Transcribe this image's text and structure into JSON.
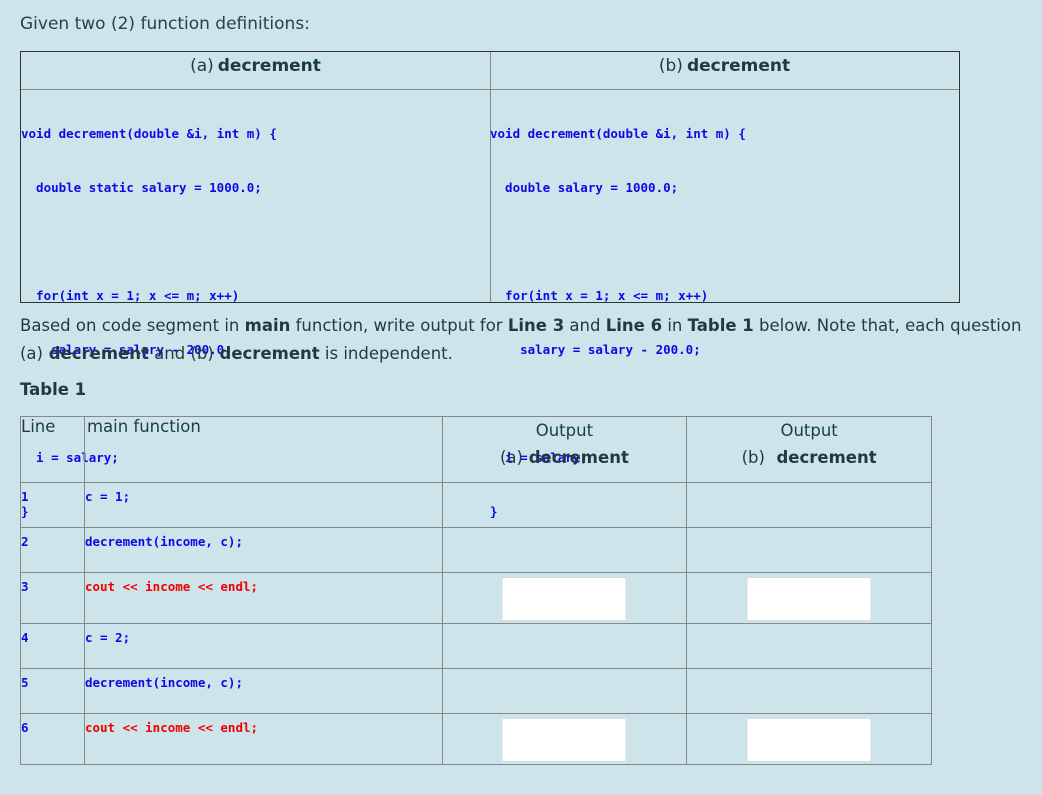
{
  "intro": "Given two (2) function definitions:",
  "definitions": [
    {
      "paren": "(a)",
      "name": "decrement",
      "code": [
        "void decrement(double &i, int m) {",
        "  double static salary = 1000.0;",
        "",
        "  for(int x = 1; x <= m; x++)",
        "    salary = salary - 200.0;",
        "",
        "  i = salary;",
        "}"
      ]
    },
    {
      "paren": "(b)",
      "name": "decrement",
      "code": [
        "void decrement(double &i, int m) {",
        "  double salary = 1000.0;",
        "",
        "  for(int x = 1; x <= m; x++)",
        "    salary = salary - 200.0;",
        "",
        "  i = salary;",
        "}"
      ]
    }
  ],
  "instruction": {
    "p1": "Based on code segment in ",
    "b1": "main",
    "p2": " function, write output for ",
    "b2": "Line 3",
    "p3": " and ",
    "b3": "Line 6",
    "p4": " in ",
    "b4": "Table 1",
    "p5": " below. Note that, each question ",
    "paren_a": "(a)",
    "b5": " decrement",
    "p6": " and ",
    "paren_b": "(b)",
    "b6": " decrement",
    "p7": " is independent."
  },
  "table_caption": "Table 1",
  "table": {
    "headers": {
      "line": "Line",
      "main": "main function",
      "out_a_title": "Output",
      "out_a_paren": "(a)",
      "out_a_name": " decrement",
      "out_b_title": "Output",
      "out_b_paren": "(b)",
      "out_b_name": "  decrement"
    },
    "rows": [
      {
        "line": "1",
        "code": "c = 1;",
        "highlight": false,
        "answer": false
      },
      {
        "line": "2",
        "code": "decrement(income, c);",
        "highlight": false,
        "answer": false
      },
      {
        "line": "3",
        "code": "cout << income << endl;",
        "highlight": true,
        "answer": true,
        "answer_a": "",
        "answer_b": ""
      },
      {
        "line": "4",
        "code": "c = 2;",
        "highlight": false,
        "answer": false
      },
      {
        "line": "5",
        "code": "decrement(income, c);",
        "highlight": false,
        "answer": false
      },
      {
        "line": "6",
        "code": "cout << income << endl;",
        "highlight": true,
        "answer": true,
        "answer_a": "",
        "answer_b": ""
      }
    ]
  },
  "colors": {
    "background": "#cde5ea",
    "code": "#0a0ae6",
    "highlight_code": "#f00000",
    "text": "#1f3a44"
  }
}
